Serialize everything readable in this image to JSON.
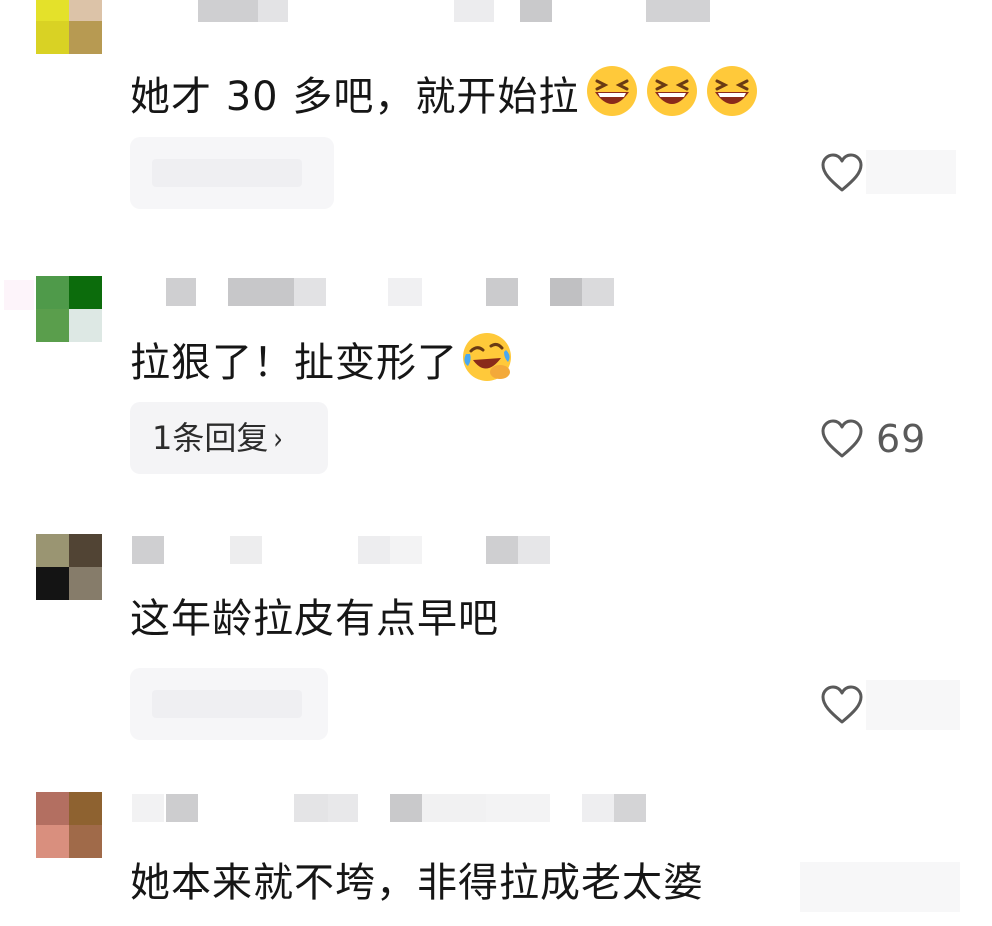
{
  "comments": [
    {
      "text": "她才 30 多吧，就开始拉",
      "emojis": [
        "grinning-squint-face",
        "grinning-squint-face",
        "grinning-squint-face"
      ],
      "reply_label": "",
      "reply_visible": false,
      "like_count": ""
    },
    {
      "text": "拉狠了！扯变形了",
      "emojis": [
        "face-with-tears-of-joy-tilted"
      ],
      "reply_label": "1条回复",
      "reply_visible": true,
      "like_count": "69"
    },
    {
      "text": "这年龄拉皮有点早吧",
      "emojis": [],
      "reply_label": "",
      "reply_visible": false,
      "like_count": ""
    },
    {
      "text": "她本来就不垮，非得拉成老太婆",
      "emojis": [],
      "reply_label": "",
      "reply_visible": false,
      "like_count": ""
    }
  ],
  "icons": {
    "like": "heart-outline-icon",
    "reply_chevron": "chevron-right-icon"
  },
  "colors": {
    "background": "#ffffff",
    "text": "#161616",
    "pill_background": "#f4f4f6",
    "icon_gray": "#5a5a5a",
    "emoji_yellow": "#ffc93a"
  },
  "symbols": {
    "chevron": "›"
  }
}
